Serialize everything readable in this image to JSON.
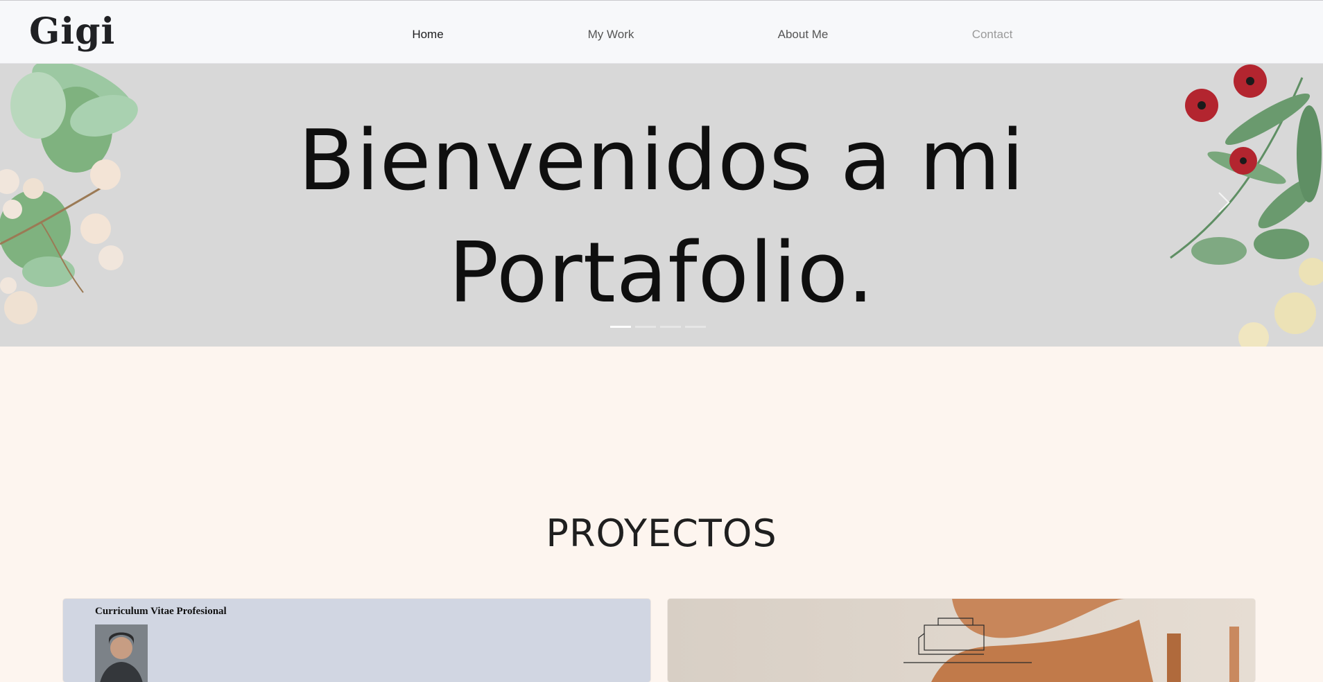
{
  "header": {
    "logo_text": "Gigi",
    "nav": [
      {
        "label": "Home",
        "state": "active"
      },
      {
        "label": "My Work",
        "state": "normal"
      },
      {
        "label": "About Me",
        "state": "normal"
      },
      {
        "label": "Contact",
        "state": "muted"
      }
    ]
  },
  "hero": {
    "title_line1": "Bienvenidos a mi",
    "title_line2": "Portafolio.",
    "slide_count": 4,
    "active_slide": 1,
    "background_color": "#d8d8d8"
  },
  "section": {
    "title": "PROYECTOS"
  },
  "projects": [
    {
      "title": "Curriculum Vitae Profesional",
      "type": "cv"
    },
    {
      "title": "",
      "type": "furniture-sketch"
    }
  ],
  "colors": {
    "page_bg": "#fdf5ef",
    "topbar_bg": "#f7f8fa",
    "cv_card_bg": "#d1d6e2"
  }
}
